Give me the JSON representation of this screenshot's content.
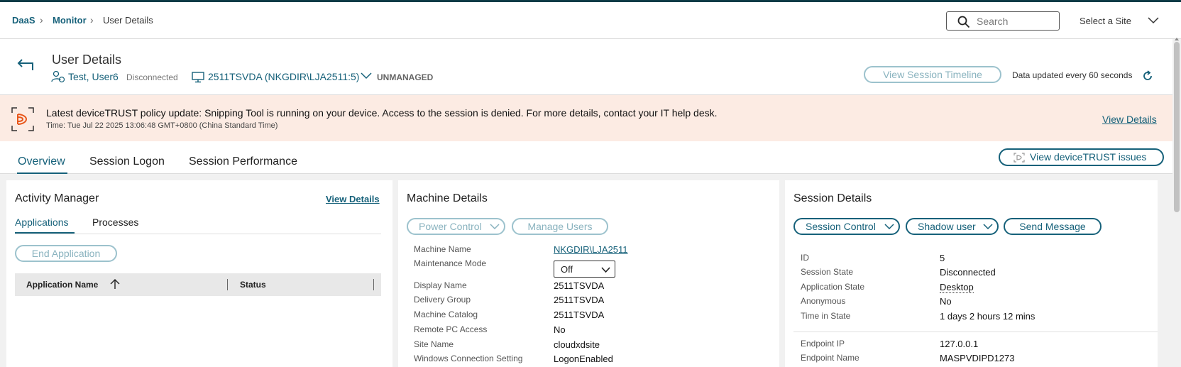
{
  "breadcrumb": {
    "items": [
      "DaaS",
      "Monitor",
      "User Details"
    ]
  },
  "search": {
    "placeholder": "Search"
  },
  "site_selector": {
    "label": "Select a Site"
  },
  "header": {
    "title": "User Details",
    "user_name": "Test, User6",
    "user_state": "Disconnected",
    "machine": "2511TSVDA (NKGDIR\\LJA2511:5)",
    "machine_status": "UNMANAGED",
    "timeline_button": "View Session Timeline",
    "updated_text": "Data updated every 60 seconds"
  },
  "alert": {
    "message": "Latest deviceTRUST policy update: Snipping Tool is running on your device. Access to the session is denied. For more details, contact your IT help desk.",
    "time": "Time: Tue Jul 22 2025 13:06:48 GMT+0800 (China Standard Time)",
    "link": "View Details"
  },
  "tabs": [
    "Overview",
    "Session Logon",
    "Session Performance"
  ],
  "devicetrust_button": "View deviceTRUST issues",
  "activity_manager": {
    "title": "Activity Manager",
    "view_details": "View Details",
    "subtabs": [
      "Applications",
      "Processes"
    ],
    "end_button": "End Application",
    "columns": [
      "Application Name",
      "Status"
    ]
  },
  "machine_details": {
    "title": "Machine Details",
    "power_button": "Power Control",
    "manage_button": "Manage Users",
    "rows": [
      {
        "label": "Machine Name",
        "value": "NKGDIR\\LJA2511"
      },
      {
        "label": "Maintenance Mode",
        "value": "Off"
      },
      {
        "label": "Display Name",
        "value": "2511TSVDA"
      },
      {
        "label": "Delivery Group",
        "value": "2511TSVDA"
      },
      {
        "label": "Machine Catalog",
        "value": "2511TSVDA"
      },
      {
        "label": "Remote PC Access",
        "value": "No"
      },
      {
        "label": "Site Name",
        "value": "cloudxdsite"
      },
      {
        "label": "Windows Connection Setting",
        "value": "LogonEnabled"
      }
    ]
  },
  "session_details": {
    "title": "Session Details",
    "session_control": "Session Control",
    "shadow_user": "Shadow user",
    "send_message": "Send Message",
    "rows": [
      {
        "label": "ID",
        "value": "5"
      },
      {
        "label": "Session State",
        "value": "Disconnected"
      },
      {
        "label": "Application State",
        "value": "Desktop"
      },
      {
        "label": "Anonymous",
        "value": "No"
      },
      {
        "label": "Time in State",
        "value": "1 days 2 hours 12 mins"
      },
      {
        "label": "Endpoint IP",
        "value": "127.0.0.1"
      },
      {
        "label": "Endpoint Name",
        "value": "MASPVDIPD1273"
      }
    ]
  },
  "colors": {
    "accent": "#16617a",
    "alert_bg": "#fcebe3",
    "topbar": "#0d3b46"
  }
}
